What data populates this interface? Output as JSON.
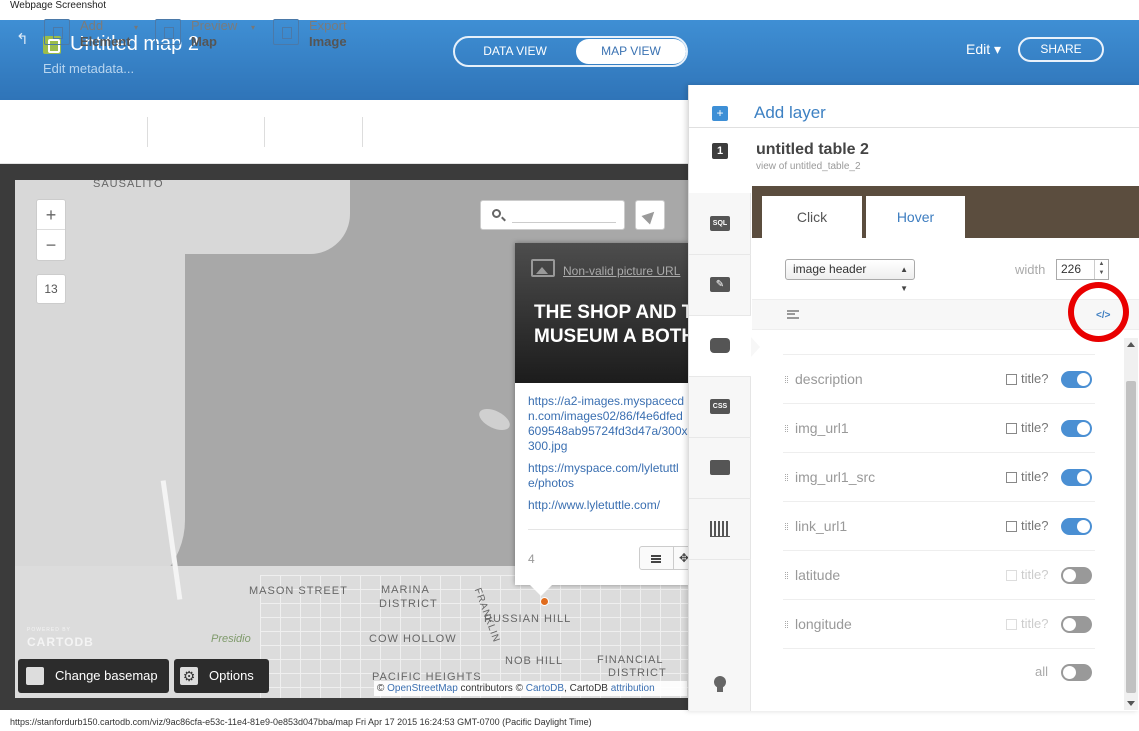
{
  "screenshot_label": "Webpage Screenshot",
  "header": {
    "map_title": "Untitled map 2",
    "edit_metadata": "Edit metadata...",
    "data_view": "DATA VIEW",
    "map_view": "MAP VIEW",
    "edit_menu": "Edit ▾",
    "share": "SHARE"
  },
  "toolbar": {
    "add_line1": "Add",
    "add_line2": "Element",
    "preview_line1": "Preview",
    "preview_line2": "Map",
    "export_line1": "Export",
    "export_line2": "Image"
  },
  "map": {
    "zoom_in": "+",
    "zoom_out": "−",
    "zoom_level": "13",
    "places": [
      "SAUSALITO",
      "MASON STREET",
      "MARINA",
      "DISTRICT",
      "RUSSIAN HILL",
      "COW HOLLOW",
      "NOB HILL",
      "FINANCIAL",
      "DISTRICT",
      "PACIFIC HEIGHTS",
      "Presidio",
      "FRANKLIN"
    ],
    "cartodb_powered": "POWERED BY",
    "cartodb_name": "CARTODB",
    "change_basemap": "Change basemap",
    "options": "Options",
    "attribution": {
      "copyright": "© ",
      "osm": "OpenStreetMap",
      "contributors": " contributors © ",
      "cartodb": "CartoDB",
      "cartodb2": ", CartoDB ",
      "attribution": "attribution"
    }
  },
  "popup": {
    "nonvalid_picture": "Non-valid picture URL",
    "title": "THE SHOP AND THE MUSEUM A BOTH...",
    "link1": "https://a2-images.myspacecdn.com/images02/86/f4e6dfed609548ab95724fd3d47a/300x300.jpg",
    "link2": "https://myspace.com/lyletuttle/photos",
    "link3": "http://www.lyletuttle.com/",
    "count": "4"
  },
  "panel": {
    "add_layer": "Add layer",
    "layer_number": "1",
    "layer_title": "untitled table 2",
    "layer_subtitle": "view of untitled_table_2",
    "side_nav": [
      "SQL",
      "✎",
      "",
      "CSS",
      "",
      ""
    ],
    "tab_click": "Click",
    "tab_hover": "Hover",
    "template_select": "image header",
    "width_label": "width",
    "width_value": "226",
    "code_icon": "</>",
    "fields": [
      {
        "name": "description",
        "title_label": "title?",
        "enabled": true
      },
      {
        "name": "img_url1",
        "title_label": "title?",
        "enabled": true
      },
      {
        "name": "img_url1_src",
        "title_label": "title?",
        "enabled": true
      },
      {
        "name": "link_url1",
        "title_label": "title?",
        "enabled": true
      },
      {
        "name": "latitude",
        "title_label": "title?",
        "enabled": false
      },
      {
        "name": "longitude",
        "title_label": "title?",
        "enabled": false
      }
    ],
    "all_label": "all"
  },
  "footer": "https://stanfordurb150.cartodb.com/viz/9ac86cfa-e53c-11e4-81e9-0e853d047bba/map Fri Apr 17 2015 16:24:53 GMT-0700 (Pacific Daylight Time)",
  "colors": {
    "header_blue": "#3a82c6",
    "link_blue": "#3a6fb1",
    "toggle_on": "#4a8fd3",
    "highlight_red": "#e90000"
  }
}
